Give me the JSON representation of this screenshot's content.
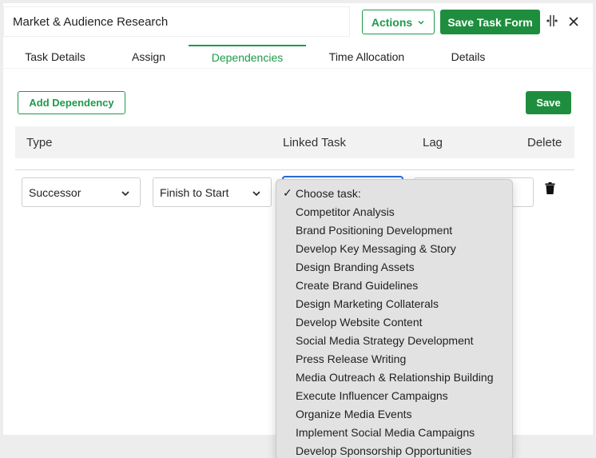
{
  "header": {
    "task_title": "Market & Audience Research",
    "actions_label": "Actions",
    "save_form_label": "Save Task Form"
  },
  "tabs": [
    {
      "label": "Task Details",
      "active": false
    },
    {
      "label": "Assign",
      "active": false
    },
    {
      "label": "Dependencies",
      "active": true
    },
    {
      "label": "Time Allocation",
      "active": false
    },
    {
      "label": "Details",
      "active": false
    }
  ],
  "dependencies": {
    "add_label": "Add Dependency",
    "save_label": "Save",
    "columns": [
      "Type",
      "Linked Task",
      "Lag",
      "Delete"
    ],
    "row": {
      "type": "Successor",
      "relation": "Finish to Start"
    }
  },
  "dropdown": {
    "selected": "Choose task:",
    "options": [
      "Choose task:",
      "Competitor Analysis",
      "Brand Positioning Development",
      "Develop Key Messaging & Story",
      "Design Branding Assets",
      "Create Brand Guidelines",
      "Design Marketing Collaterals",
      "Develop Website Content",
      "Social Media Strategy Development",
      "Press Release Writing",
      "Media Outreach & Relationship Building",
      "Execute Influencer Campaigns",
      "Organize Media Events",
      "Implement Social Media Campaigns",
      "Develop Sponsorship Opportunities"
    ]
  },
  "colors": {
    "accent": "#1e9a4a",
    "focus": "#2a6bd8"
  }
}
